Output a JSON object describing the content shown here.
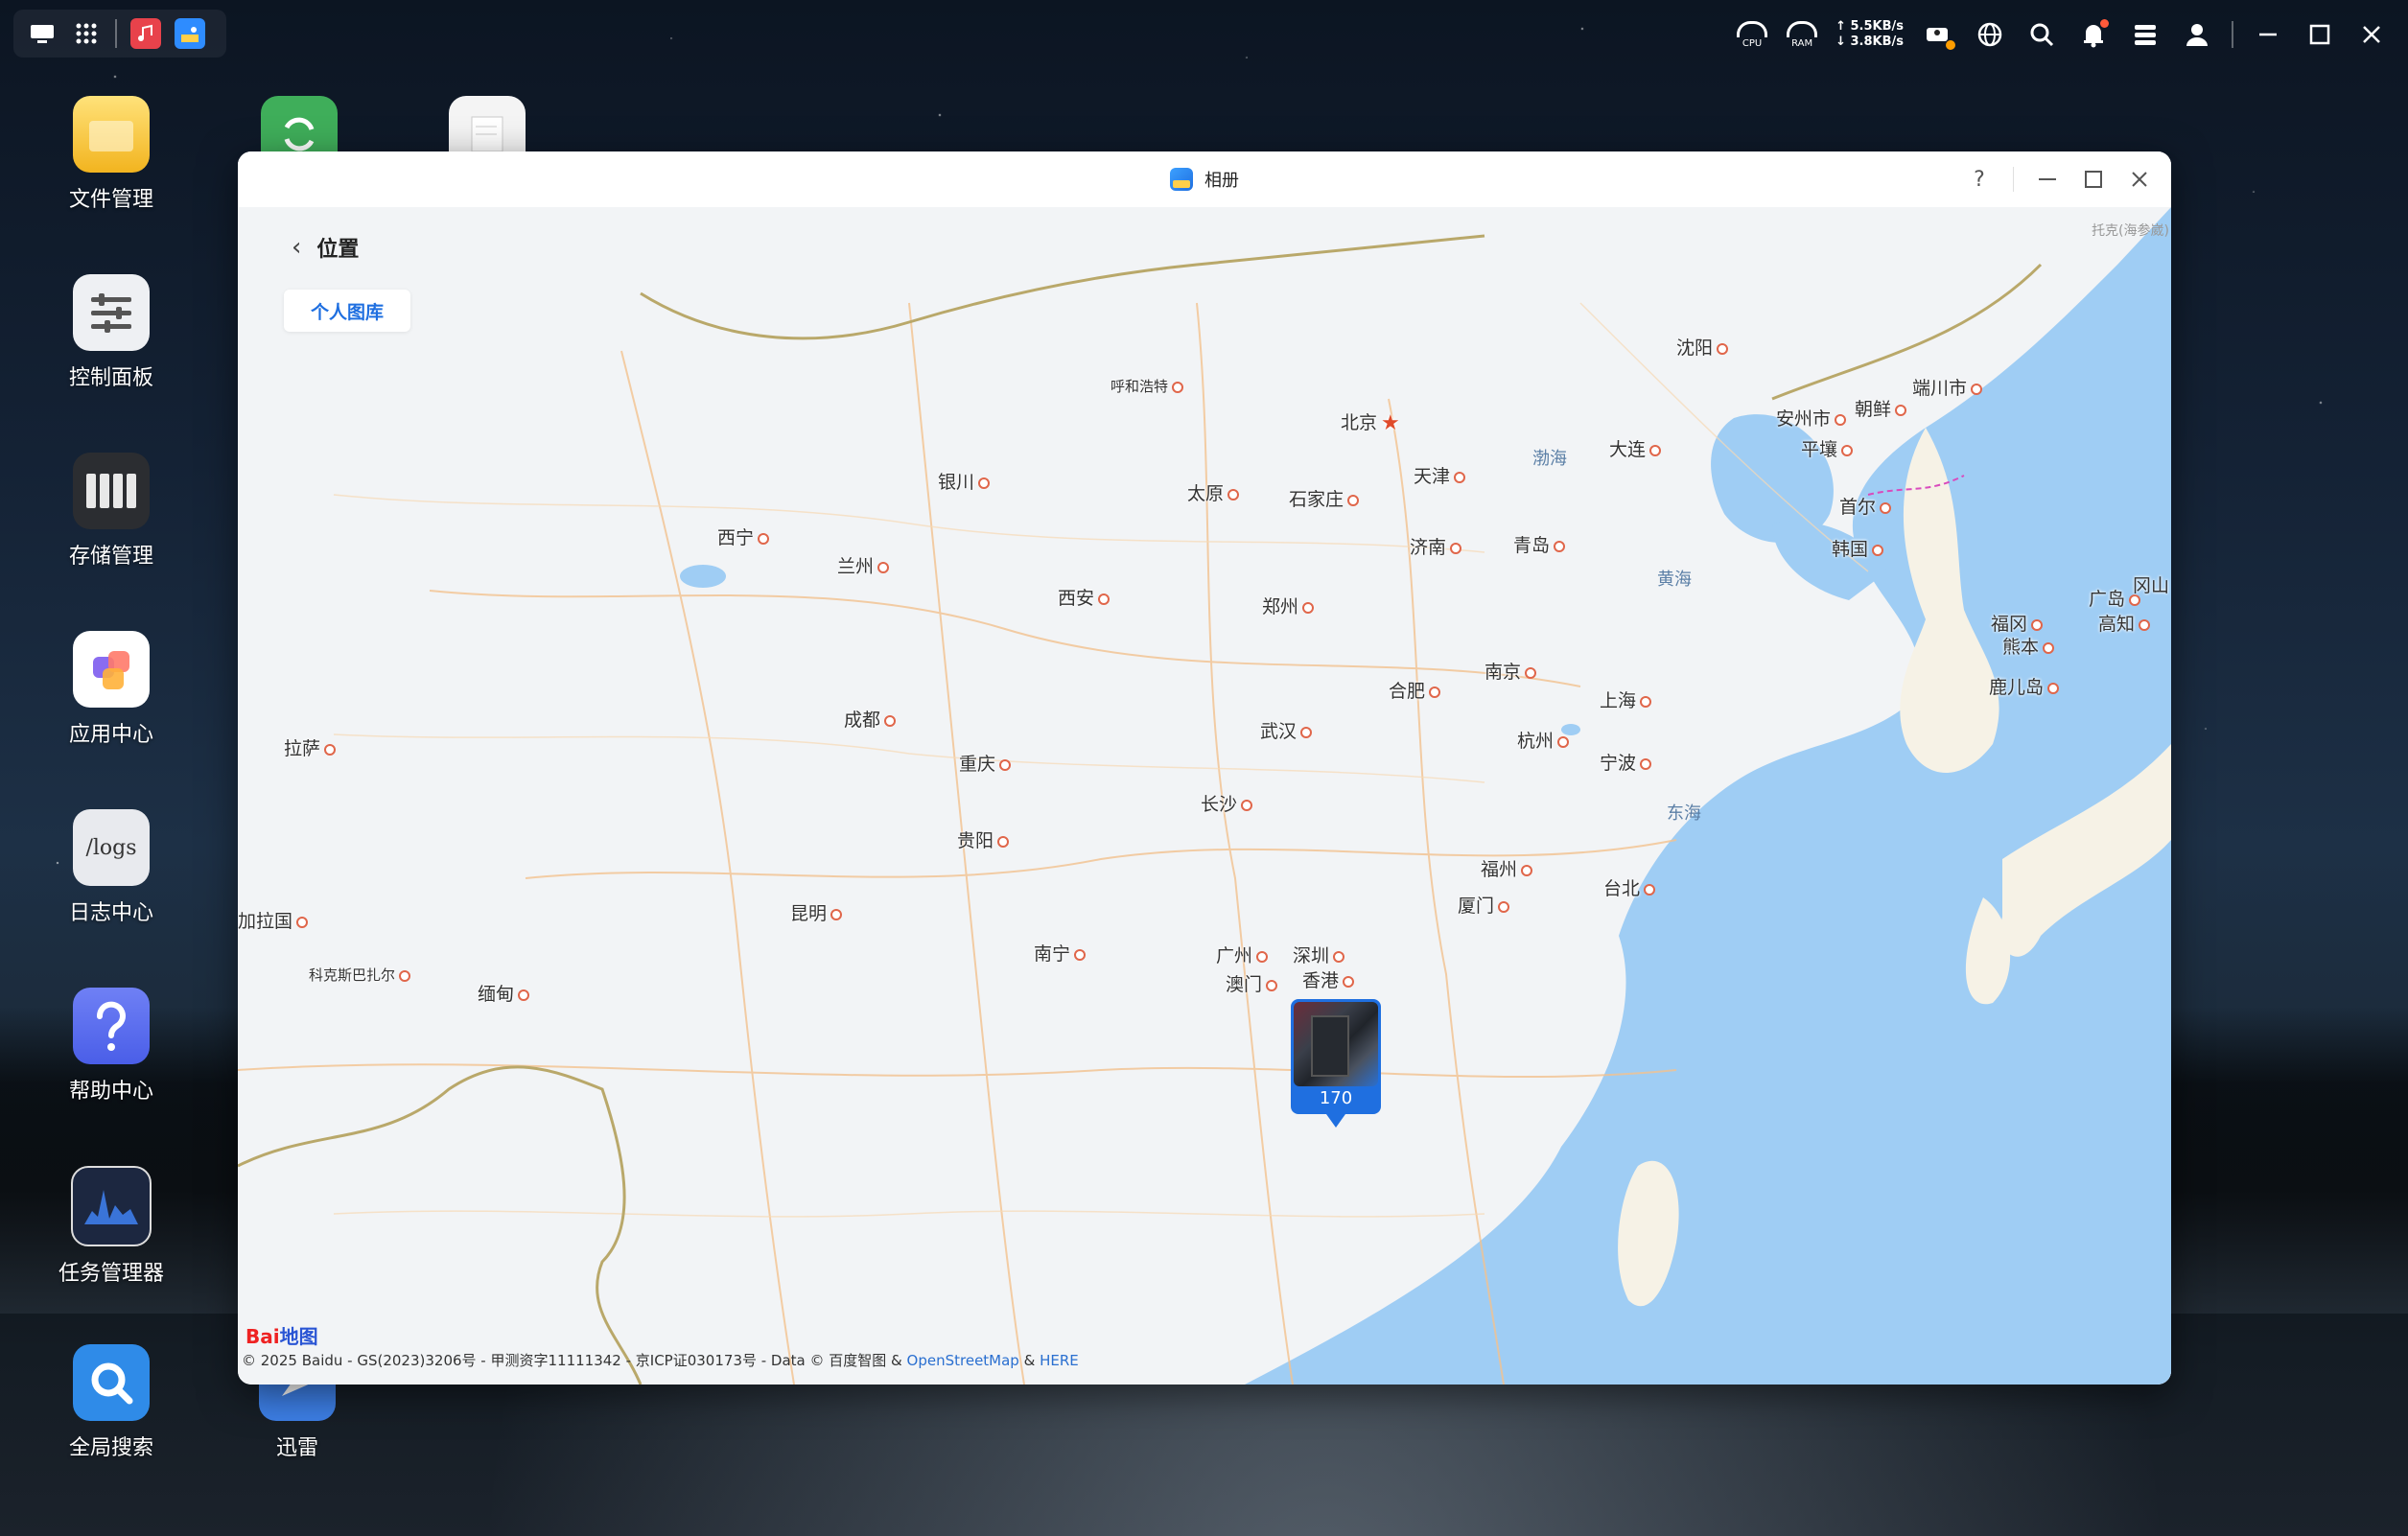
{
  "taskbar": {
    "left_icons": [
      "desktop-icon",
      "apps-grid-icon",
      "music-app-icon",
      "photos-app-icon"
    ],
    "cpu_label": "CPU",
    "ram_label": "RAM",
    "upload_speed": "↑ 5.5KB/s",
    "download_speed": "↓ 3.8KB/s"
  },
  "desktop_icons": [
    {
      "label": "文件管理",
      "icon": "folder-icon",
      "color": "#f5c842"
    },
    {
      "label": "控制面板",
      "icon": "sliders-icon",
      "color": "#e9ecef"
    },
    {
      "label": "存储管理",
      "icon": "storage-icon",
      "color": "#2d2f33"
    },
    {
      "label": "应用中心",
      "icon": "app-center-icon",
      "color": "#ffffff"
    },
    {
      "label": "日志中心",
      "icon": "logs-icon",
      "color": "#e9ecef"
    },
    {
      "label": "帮助中心",
      "icon": "help-icon",
      "color": "#5a6ff0"
    },
    {
      "label": "任务管理器",
      "icon": "task-manager-icon",
      "color": "#1e2a44"
    },
    {
      "label": "全局搜索",
      "icon": "global-search-icon",
      "color": "#2f8be8"
    },
    {
      "label": "迅雷",
      "icon": "xunlei-icon",
      "color": "#3d7fe6"
    }
  ],
  "logs_icon_text": "/logs",
  "window": {
    "title": "相册",
    "help": "?",
    "back_label": "位置",
    "library_button": "个人图库"
  },
  "map": {
    "cities": [
      {
        "name": "北京",
        "capital": true
      },
      {
        "name": "天津"
      },
      {
        "name": "呼和浩特"
      },
      {
        "name": "沈阳"
      },
      {
        "name": "大连"
      },
      {
        "name": "石家庄"
      },
      {
        "name": "太原"
      },
      {
        "name": "银川"
      },
      {
        "name": "西宁"
      },
      {
        "name": "兰州"
      },
      {
        "name": "济南"
      },
      {
        "name": "青岛"
      },
      {
        "name": "郑州"
      },
      {
        "name": "西安"
      },
      {
        "name": "南京"
      },
      {
        "name": "合肥"
      },
      {
        "name": "上海"
      },
      {
        "name": "成都"
      },
      {
        "name": "武汉"
      },
      {
        "name": "杭州"
      },
      {
        "name": "宁波"
      },
      {
        "name": "重庆"
      },
      {
        "name": "长沙"
      },
      {
        "name": "贵阳"
      },
      {
        "name": "拉萨"
      },
      {
        "name": "昆明"
      },
      {
        "name": "福州"
      },
      {
        "name": "台北"
      },
      {
        "name": "厦门"
      },
      {
        "name": "南宁"
      },
      {
        "name": "广州"
      },
      {
        "name": "深圳"
      },
      {
        "name": "香港"
      },
      {
        "name": "澳门"
      },
      {
        "name": "平壤"
      },
      {
        "name": "首尔"
      },
      {
        "name": "韩国"
      },
      {
        "name": "朝鲜"
      },
      {
        "name": "安州市"
      },
      {
        "name": "端川市"
      },
      {
        "name": "福冈"
      },
      {
        "name": "熊本"
      },
      {
        "name": "鹿儿岛"
      },
      {
        "name": "广岛"
      },
      {
        "name": "高知"
      },
      {
        "name": "冈山"
      },
      {
        "name": "加拉国"
      },
      {
        "name": "科克斯巴扎尔"
      },
      {
        "name": "缅甸"
      }
    ],
    "seas": [
      "渤海",
      "黄海",
      "东海"
    ],
    "photo_count": "170",
    "corner_text": "托克(海参崴)",
    "logo_prefix": "Bai",
    "logo_suffix": "地图",
    "copyright": "© 2025 Baidu - GS(2023)3206号 - 甲测资字11111342 - 京ICP证030173号 - Data © 百度智图 & ",
    "link_osm": "OpenStreetMap",
    "link_sep": " & ",
    "link_here": "HERE"
  }
}
